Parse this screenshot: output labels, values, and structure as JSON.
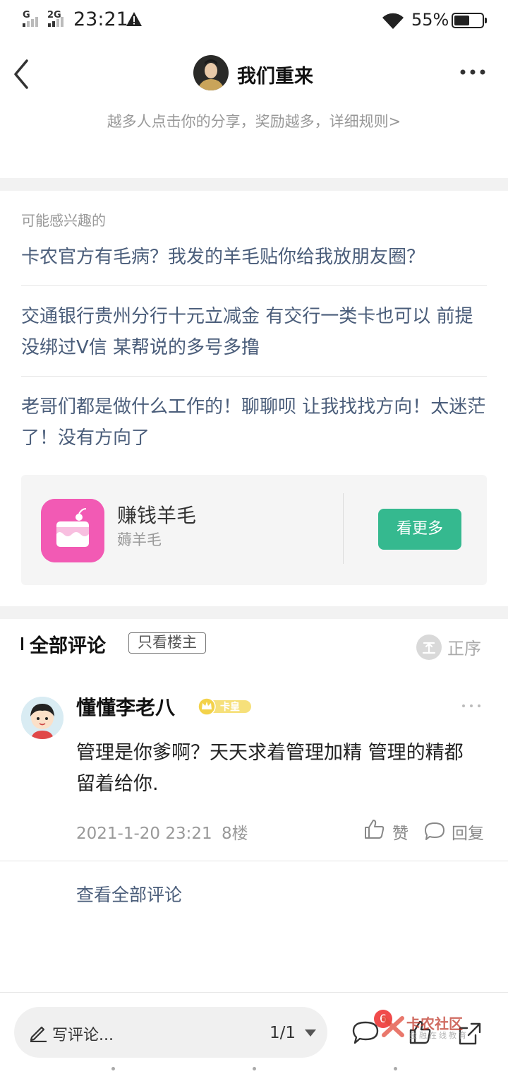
{
  "status_bar": {
    "sim1": "G",
    "sim2": "2G",
    "time": "23:21",
    "battery_pct": "55%",
    "battery_level": 0.55
  },
  "header": {
    "title": "我们重来",
    "share_hint": "越多人点击你的分享，奖励越多，详细规则>"
  },
  "interest": {
    "label": "可能感兴趣的",
    "items": [
      "卡农官方有毛病？我发的羊毛贴你给我放朋友圈？",
      "交通银行贵州分行十元立减金 有交行一类卡也可以 前提没绑过V信 某帮说的多号多撸",
      "老哥们都是做什么工作的！聊聊呗 让我找找方向！太迷茫了！没有方向了"
    ]
  },
  "app_card": {
    "name": "赚钱羊毛",
    "sub": "薅羊毛",
    "button": "看更多",
    "accent": "#35b98f",
    "icon_color": "#f25ab4"
  },
  "comments": {
    "title": "全部评论",
    "op_only": "只看楼主",
    "sort": "正序",
    "list": [
      {
        "user": "懂懂李老八",
        "badge": "卡皇",
        "text": "管理是你爹啊？天天求着管理加精 管理的精都留着给你.",
        "time": "2021-1-20 23:21",
        "floor": "8楼",
        "like": "赞",
        "reply": "回复"
      }
    ],
    "view_all": "查看全部评论"
  },
  "bottom_bar": {
    "write_placeholder": "写评论...",
    "page": "1/1",
    "comment_count": "6",
    "watermark": "卡农社区",
    "watermark_sub": "金融在线教育"
  }
}
